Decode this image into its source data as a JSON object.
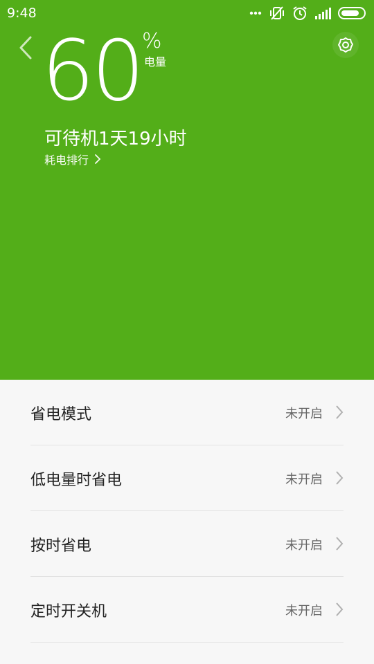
{
  "status_bar": {
    "time": "9:48",
    "icons": [
      "more-dots-icon",
      "vibrate-off-icon",
      "alarm-icon",
      "signal-icon",
      "battery-icon"
    ]
  },
  "header": {
    "back_icon": "chevron-left-icon",
    "settings_icon": "gear-icon",
    "battery_percent": "60",
    "percent_symbol": "%",
    "battery_label": "电量",
    "standby_text": "可待机1天19小时",
    "ranking_link": "耗电排行"
  },
  "settings": [
    {
      "label": "省电模式",
      "status": "未开启"
    },
    {
      "label": "低电量时省电",
      "status": "未开启"
    },
    {
      "label": "按时省电",
      "status": "未开启"
    },
    {
      "label": "定时开关机",
      "status": "未开启"
    }
  ],
  "colors": {
    "accent_green": "#53ae19",
    "list_background": "#f7f7f7",
    "divider": "#e2e2e2"
  }
}
